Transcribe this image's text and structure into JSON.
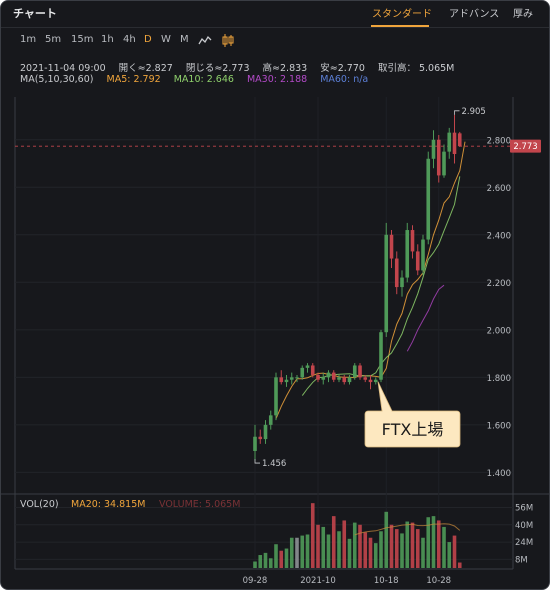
{
  "header": {
    "title": "チャート",
    "tabs": [
      {
        "label": "スタンダード",
        "active": true
      },
      {
        "label": "アドバンス",
        "active": false
      },
      {
        "label": "厚み",
        "active": false
      }
    ]
  },
  "toolbar": {
    "timeframes": [
      {
        "label": "1m",
        "active": false
      },
      {
        "label": "5m",
        "active": false
      },
      {
        "label": "15m",
        "active": false
      },
      {
        "label": "1h",
        "active": false
      },
      {
        "label": "4h",
        "active": false
      },
      {
        "label": "D",
        "active": true
      },
      {
        "label": "W",
        "active": false
      },
      {
        "label": "M",
        "active": false
      }
    ],
    "chart_types": [
      {
        "icon": "line-chart-icon",
        "active": false
      },
      {
        "icon": "candlestick-icon",
        "active": true
      }
    ]
  },
  "ohlc": {
    "date": "2021-11-04 09:00",
    "open": "開く≈2.827",
    "close": "閉じる≈2.773",
    "high": "高≈2.833",
    "low": "安≈2.770",
    "volume": "取引高： 5.065M"
  },
  "ma": {
    "label": "MA(5,10,30,60)",
    "ma5": "MA5: 2.792",
    "ma10": "MA10: 2.646",
    "ma30": "MA30: 2.188",
    "ma60": "MA60: n/a"
  },
  "vol": {
    "label": "VOL(20)",
    "ma20": "MA20: 34.815M",
    "volume": "VOLUME: 5.065M"
  },
  "colors": {
    "up": "#4f9a59",
    "down": "#c2454c",
    "neutral": "#8e9196",
    "ma5": "#f0a53c",
    "ma10": "#8fd16c",
    "ma30": "#a742b8",
    "ma60": "#5c7fd6",
    "accent": "#f0a53c",
    "price_line": "#c2454c"
  },
  "chart_data": {
    "type": "candlestick",
    "price_axis": {
      "ticks": [
        1.4,
        1.6,
        1.8,
        2.0,
        2.2,
        2.4,
        2.6,
        2.8
      ],
      "tick_labels": [
        "1.400",
        "1.600",
        "1.800",
        "2.000",
        "2.200",
        "2.400",
        "2.600",
        "2.800"
      ],
      "range": [
        1.33,
        2.98
      ]
    },
    "volume_axis": {
      "ticks": [
        8,
        24,
        40,
        56
      ],
      "tick_labels": [
        "8M",
        "24M",
        "40M",
        "56M"
      ],
      "range": [
        0,
        62
      ],
      "unit": "M"
    },
    "x_ticks": [
      {
        "index": 0,
        "label": "09-28"
      },
      {
        "index": 12,
        "label": "2021-10"
      },
      {
        "index": 25,
        "label": "10-18"
      },
      {
        "index": 35,
        "label": "10-28"
      }
    ],
    "last_price": {
      "value": 2.773,
      "label": "2.773"
    },
    "high_marker": {
      "index": 38,
      "value": 2.905,
      "label": "2.905"
    },
    "low_marker": {
      "index": 0,
      "value": 1.456,
      "label": "1.456"
    },
    "annotation": {
      "text": "FTX上場",
      "index": 24,
      "value": 1.79
    },
    "candles": [
      {
        "o": 1.49,
        "h": 1.6,
        "l": 1.45,
        "c": 1.55,
        "v": 6
      },
      {
        "o": 1.55,
        "h": 1.58,
        "l": 1.52,
        "c": 1.54,
        "v": 12
      },
      {
        "o": 1.54,
        "h": 1.62,
        "l": 1.52,
        "c": 1.6,
        "v": 14
      },
      {
        "o": 1.6,
        "h": 1.66,
        "l": 1.58,
        "c": 1.64,
        "v": 9
      },
      {
        "o": 1.64,
        "h": 1.82,
        "l": 1.62,
        "c": 1.8,
        "v": 22
      },
      {
        "o": 1.8,
        "h": 1.83,
        "l": 1.77,
        "c": 1.78,
        "v": 16
      },
      {
        "o": 1.78,
        "h": 1.81,
        "l": 1.76,
        "c": 1.79,
        "v": 18
      },
      {
        "o": 1.79,
        "h": 1.82,
        "l": 1.77,
        "c": 1.8,
        "v": 28
      },
      {
        "o": 1.8,
        "h": 1.81,
        "l": 1.78,
        "c": 1.8,
        "v": 28
      },
      {
        "o": 1.8,
        "h": 1.85,
        "l": 1.79,
        "c": 1.84,
        "v": 30
      },
      {
        "o": 1.84,
        "h": 1.86,
        "l": 1.82,
        "c": 1.85,
        "v": 31
      },
      {
        "o": 1.85,
        "h": 1.86,
        "l": 1.8,
        "c": 1.81,
        "v": 60
      },
      {
        "o": 1.81,
        "h": 1.82,
        "l": 1.78,
        "c": 1.79,
        "v": 40
      },
      {
        "o": 1.79,
        "h": 1.82,
        "l": 1.77,
        "c": 1.8,
        "v": 38
      },
      {
        "o": 1.8,
        "h": 1.83,
        "l": 1.78,
        "c": 1.82,
        "v": 31
      },
      {
        "o": 1.82,
        "h": 1.83,
        "l": 1.78,
        "c": 1.79,
        "v": 48
      },
      {
        "o": 1.79,
        "h": 1.81,
        "l": 1.78,
        "c": 1.8,
        "v": 34
      },
      {
        "o": 1.8,
        "h": 1.81,
        "l": 1.77,
        "c": 1.78,
        "v": 44
      },
      {
        "o": 1.78,
        "h": 1.81,
        "l": 1.77,
        "c": 1.8,
        "v": 27
      },
      {
        "o": 1.8,
        "h": 1.86,
        "l": 1.79,
        "c": 1.85,
        "v": 42
      },
      {
        "o": 1.85,
        "h": 1.86,
        "l": 1.79,
        "c": 1.8,
        "v": 40
      },
      {
        "o": 1.8,
        "h": 1.81,
        "l": 1.78,
        "c": 1.79,
        "v": 33
      },
      {
        "o": 1.79,
        "h": 1.81,
        "l": 1.75,
        "c": 1.78,
        "v": 28
      },
      {
        "o": 1.78,
        "h": 1.8,
        "l": 1.77,
        "c": 1.79,
        "v": 23
      },
      {
        "o": 1.79,
        "h": 2.0,
        "l": 1.78,
        "c": 1.99,
        "v": 34
      },
      {
        "o": 1.99,
        "h": 2.45,
        "l": 1.97,
        "c": 2.4,
        "v": 52
      },
      {
        "o": 2.4,
        "h": 2.42,
        "l": 2.26,
        "c": 2.3,
        "v": 40
      },
      {
        "o": 2.3,
        "h": 2.33,
        "l": 2.15,
        "c": 2.18,
        "v": 36
      },
      {
        "o": 2.18,
        "h": 2.25,
        "l": 2.14,
        "c": 2.22,
        "v": 32
      },
      {
        "o": 2.22,
        "h": 2.45,
        "l": 2.2,
        "c": 2.42,
        "v": 43
      },
      {
        "o": 2.42,
        "h": 2.44,
        "l": 2.3,
        "c": 2.33,
        "v": 42
      },
      {
        "o": 2.33,
        "h": 2.36,
        "l": 2.23,
        "c": 2.25,
        "v": 36
      },
      {
        "o": 2.25,
        "h": 2.4,
        "l": 2.23,
        "c": 2.38,
        "v": 28
      },
      {
        "o": 2.38,
        "h": 2.75,
        "l": 2.36,
        "c": 2.72,
        "v": 47
      },
      {
        "o": 2.72,
        "h": 2.84,
        "l": 2.68,
        "c": 2.8,
        "v": 48
      },
      {
        "o": 2.8,
        "h": 2.82,
        "l": 2.62,
        "c": 2.65,
        "v": 44
      },
      {
        "o": 2.65,
        "h": 2.78,
        "l": 2.64,
        "c": 2.75,
        "v": 38
      },
      {
        "o": 2.75,
        "h": 2.85,
        "l": 2.72,
        "c": 2.83,
        "v": 24
      },
      {
        "o": 2.83,
        "h": 2.905,
        "l": 2.7,
        "c": 2.74,
        "v": 30
      },
      {
        "o": 2.827,
        "h": 2.833,
        "l": 2.77,
        "c": 2.773,
        "v": 5.065
      }
    ],
    "moving_averages": [
      {
        "name": "MA5",
        "start": 4,
        "values": [
          1.626,
          1.678,
          1.722,
          1.762,
          1.794,
          1.794,
          1.798,
          1.808,
          1.816,
          1.818,
          1.812,
          1.808,
          1.802,
          1.8,
          1.8,
          1.798,
          1.808,
          1.806,
          1.806,
          1.804,
          1.8,
          1.838,
          1.952,
          2.024,
          2.069,
          2.15,
          2.19,
          2.212,
          2.24,
          2.318,
          2.4,
          2.462,
          2.534,
          2.56,
          2.618,
          2.67,
          2.792
        ]
      },
      {
        "name": "MA10",
        "start": 9,
        "values": [
          1.723,
          1.753,
          1.779,
          1.799,
          1.8,
          1.808,
          1.811,
          1.813,
          1.814,
          1.815,
          1.81,
          1.806,
          1.806,
          1.806,
          1.819,
          1.857,
          1.883,
          1.903,
          1.941,
          1.983,
          2.046,
          2.095,
          2.152,
          2.221,
          2.297,
          2.325,
          2.361,
          2.417,
          2.472,
          2.528,
          2.646
        ]
      },
      {
        "name": "MA30",
        "start": 29,
        "values": [
          1.91,
          1.95,
          2.0,
          2.04,
          2.08,
          2.13,
          2.17,
          2.188
        ]
      },
      {
        "name": "MA60",
        "start": null,
        "values": []
      }
    ],
    "volume_ma20": {
      "start": 19,
      "values": [
        30.6,
        32.3,
        33.3,
        34.0,
        34.4,
        35.7,
        37.2,
        37.9,
        38.8,
        39.7,
        40.1,
        40.4,
        39.3,
        39.2,
        39.6,
        40.6,
        40.6,
        41.0,
        40.6,
        38.9,
        34.815
      ]
    },
    "volume_colors": [
      "up",
      "up",
      "up",
      "up",
      "up",
      "down",
      "up",
      "up",
      "neutral",
      "up",
      "up",
      "down",
      "down",
      "up",
      "up",
      "down",
      "up",
      "down",
      "up",
      "up",
      "down",
      "down",
      "down",
      "up",
      "up",
      "up",
      "down",
      "down",
      "up",
      "up",
      "down",
      "down",
      "up",
      "up",
      "up",
      "down",
      "up",
      "up",
      "down",
      "down"
    ]
  }
}
